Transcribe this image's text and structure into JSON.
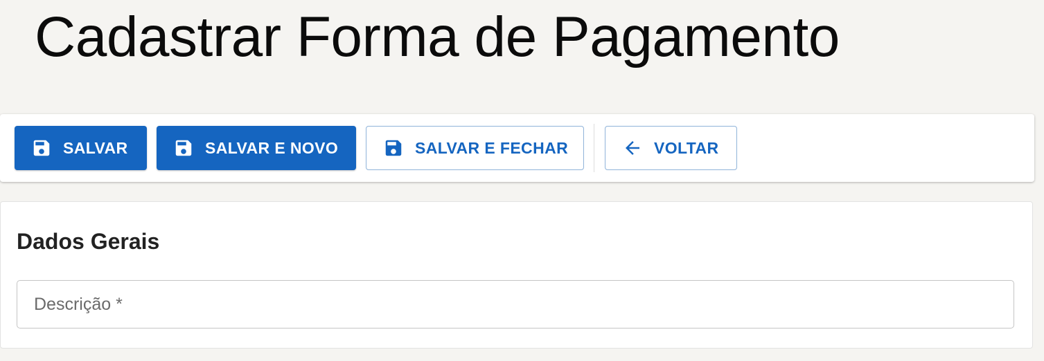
{
  "page": {
    "title": "Cadastrar Forma de Pagamento"
  },
  "toolbar": {
    "buttons": [
      {
        "label": "SALVAR",
        "icon": "save-icon",
        "variant": "primary"
      },
      {
        "label": "SALVAR E NOVO",
        "icon": "save-icon",
        "variant": "primary"
      },
      {
        "label": "SALVAR E FECHAR",
        "icon": "save-icon",
        "variant": "outline"
      },
      {
        "label": "VOLTAR",
        "icon": "arrow-left-icon",
        "variant": "outline"
      }
    ]
  },
  "form": {
    "section_title": "Dados Gerais",
    "fields": [
      {
        "placeholder": "Descrição *",
        "value": ""
      }
    ]
  },
  "colors": {
    "accent": "#1565c0",
    "background": "#f5f4f1",
    "surface": "#ffffff"
  }
}
